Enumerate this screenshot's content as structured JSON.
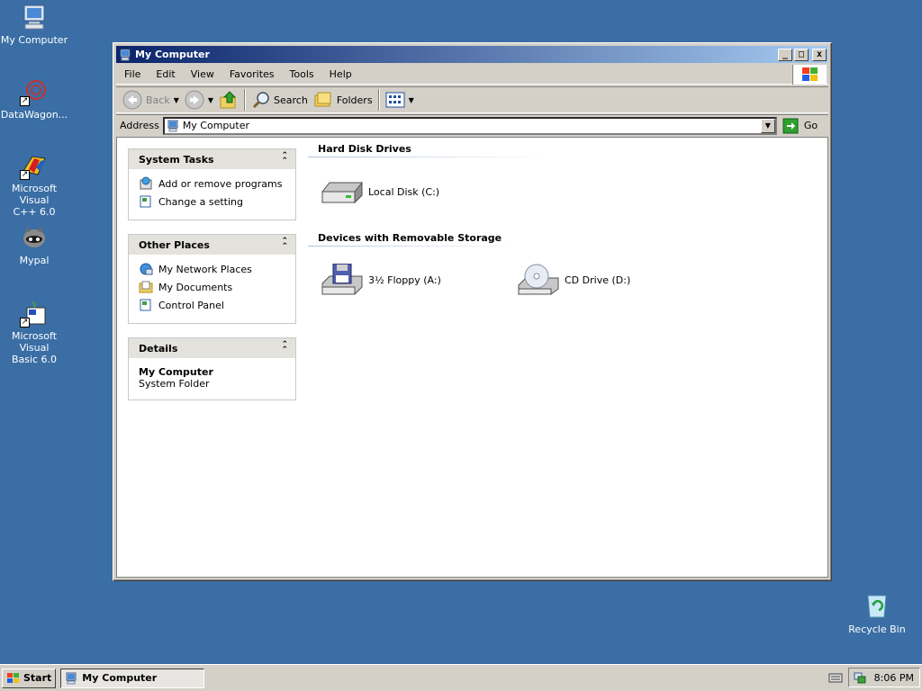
{
  "desktop": {
    "icons": [
      {
        "label": "My Computer"
      },
      {
        "label": "DataWagon..."
      },
      {
        "label_line1": "Microsoft Visual",
        "label_line2": "C++ 6.0"
      },
      {
        "label": "Mypal"
      },
      {
        "label_line1": "Microsoft Visual",
        "label_line2": "Basic 6.0"
      },
      {
        "label": "Recycle Bin"
      }
    ]
  },
  "window": {
    "title": "My Computer",
    "controls": {
      "minimize": "_",
      "maximize": "□",
      "close": "x"
    },
    "menu": [
      "File",
      "Edit",
      "View",
      "Favorites",
      "Tools",
      "Help"
    ],
    "toolbar": {
      "back": "Back",
      "search": "Search",
      "folders": "Folders"
    },
    "address": {
      "label": "Address",
      "value": "My Computer",
      "go": "Go"
    },
    "tasks": {
      "system_tasks": {
        "title": "System Tasks",
        "items": [
          "Add or remove programs",
          "Change a setting"
        ]
      },
      "other_places": {
        "title": "Other Places",
        "items": [
          "My Network Places",
          "My Documents",
          "Control Panel"
        ]
      },
      "details": {
        "title": "Details",
        "name": "My Computer",
        "type": "System Folder"
      }
    },
    "sections": {
      "hard_disk": {
        "title": "Hard Disk Drives",
        "drives": [
          "Local Disk (C:)"
        ]
      },
      "removable": {
        "title": "Devices with Removable Storage",
        "drives": [
          "3½ Floppy (A:)",
          "CD Drive (D:)"
        ]
      }
    }
  },
  "taskbar": {
    "start": "Start",
    "task": "My Computer",
    "clock": "8:06 PM"
  },
  "colors": {
    "desktop": "#3a6ea5",
    "title_start": "#0a246a",
    "title_end": "#a6caf0",
    "chrome": "#d4d0c8"
  }
}
